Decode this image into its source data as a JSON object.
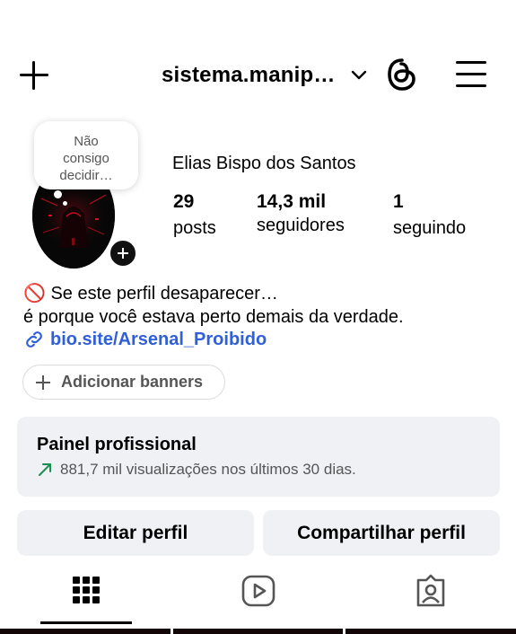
{
  "header": {
    "username": "sistema.manip…",
    "icons": {
      "create": "plus-icon",
      "switch_account": "chevron-down-icon",
      "threads": "threads-icon",
      "menu": "hamburger-menu-icon"
    }
  },
  "profile": {
    "note": [
      "Não",
      "consigo",
      "decidir…"
    ],
    "full_name": "Elias Bispo dos Santos",
    "stats": [
      {
        "value": "29",
        "label": "posts"
      },
      {
        "value": "14,3 mil",
        "label": "seguidores"
      },
      {
        "value": "1",
        "label": "seguindo"
      }
    ]
  },
  "bio": {
    "line1": "🚫 Se este perfil desaparecer…",
    "line2": "é porque você estava perto demais da verdade.",
    "link": "bio.site/Arsenal_Proibido"
  },
  "banner_button": "Adicionar banners",
  "dashboard": {
    "title": "Painel profissional",
    "subtitle": "881,7 mil visualizações nos últimos 30 dias."
  },
  "actions": {
    "edit": "Editar perfil",
    "share": "Compartilhar perfil"
  },
  "tabs": [
    "grid-icon",
    "reels-icon",
    "tagged-icon"
  ],
  "colors": {
    "link": "#2f5fd9",
    "trend": "#1a8f52",
    "panel": "#eff1f4"
  }
}
